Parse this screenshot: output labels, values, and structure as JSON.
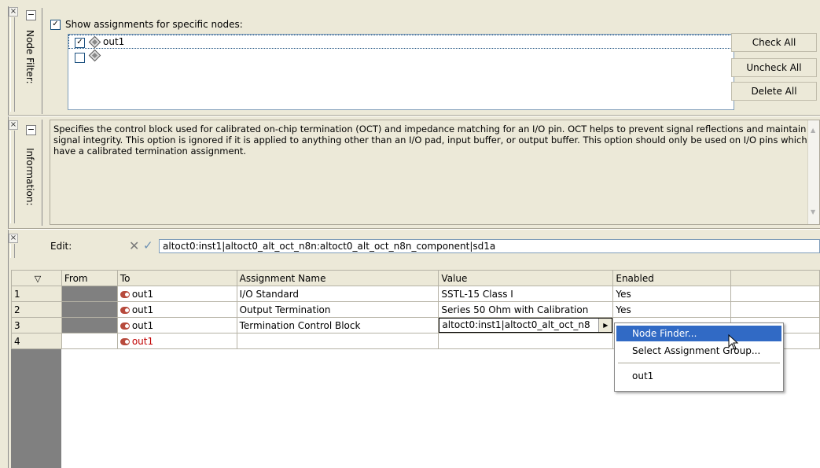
{
  "node_filter": {
    "title": "Node Filter:",
    "show_specific_checked": true,
    "show_specific_label": "Show assignments for specific nodes:",
    "nodes": [
      {
        "checked": true,
        "label": "out1"
      },
      {
        "checked": false,
        "label": ""
      }
    ],
    "buttons": {
      "check_all": "Check All",
      "uncheck_all": "Uncheck All",
      "delete_all": "Delete All"
    }
  },
  "information": {
    "title": "Information:",
    "text": "Specifies the control block used for calibrated on-chip termination (OCT) and impedance matching for an I/O pin. OCT helps to prevent signal reflections and maintain signal integrity. This option is ignored if it is applied to anything other than an I/O pad, input buffer, or output buffer. This option should only be used on I/O pins which have a calibrated termination assignment."
  },
  "edit": {
    "label": "Edit:",
    "value": "altoct0:inst1|altoct0_alt_oct_n8n:altoct0_alt_oct_n8n_component|sd1a"
  },
  "table": {
    "columns": [
      "",
      "From",
      "To",
      "Assignment Name",
      "Value",
      "Enabled",
      ""
    ],
    "rows": [
      {
        "num": "1",
        "from": "",
        "to": "out1",
        "assignment": "I/O Standard",
        "value": "SSTL-15 Class I",
        "enabled": "Yes"
      },
      {
        "num": "2",
        "from": "",
        "to": "out1",
        "assignment": "Output Termination",
        "value": "Series 50 Ohm with Calibration",
        "enabled": "Yes"
      },
      {
        "num": "3",
        "from": "",
        "to": "out1",
        "assignment": "Termination Control Block",
        "value": "altoct0:inst1|altoct0_alt_oct_n8",
        "enabled": ""
      },
      {
        "num": "4",
        "from": "",
        "to": "out1",
        "assignment": "",
        "value": "",
        "enabled": ""
      }
    ]
  },
  "context_menu": {
    "items": [
      "Node Finder...",
      "Select Assignment Group...",
      "out1"
    ],
    "highlighted_index": 0
  },
  "colors": {
    "menu_highlight": "#316ac5",
    "new_row_text": "#c00000",
    "panel_border": "#7f9db9"
  }
}
